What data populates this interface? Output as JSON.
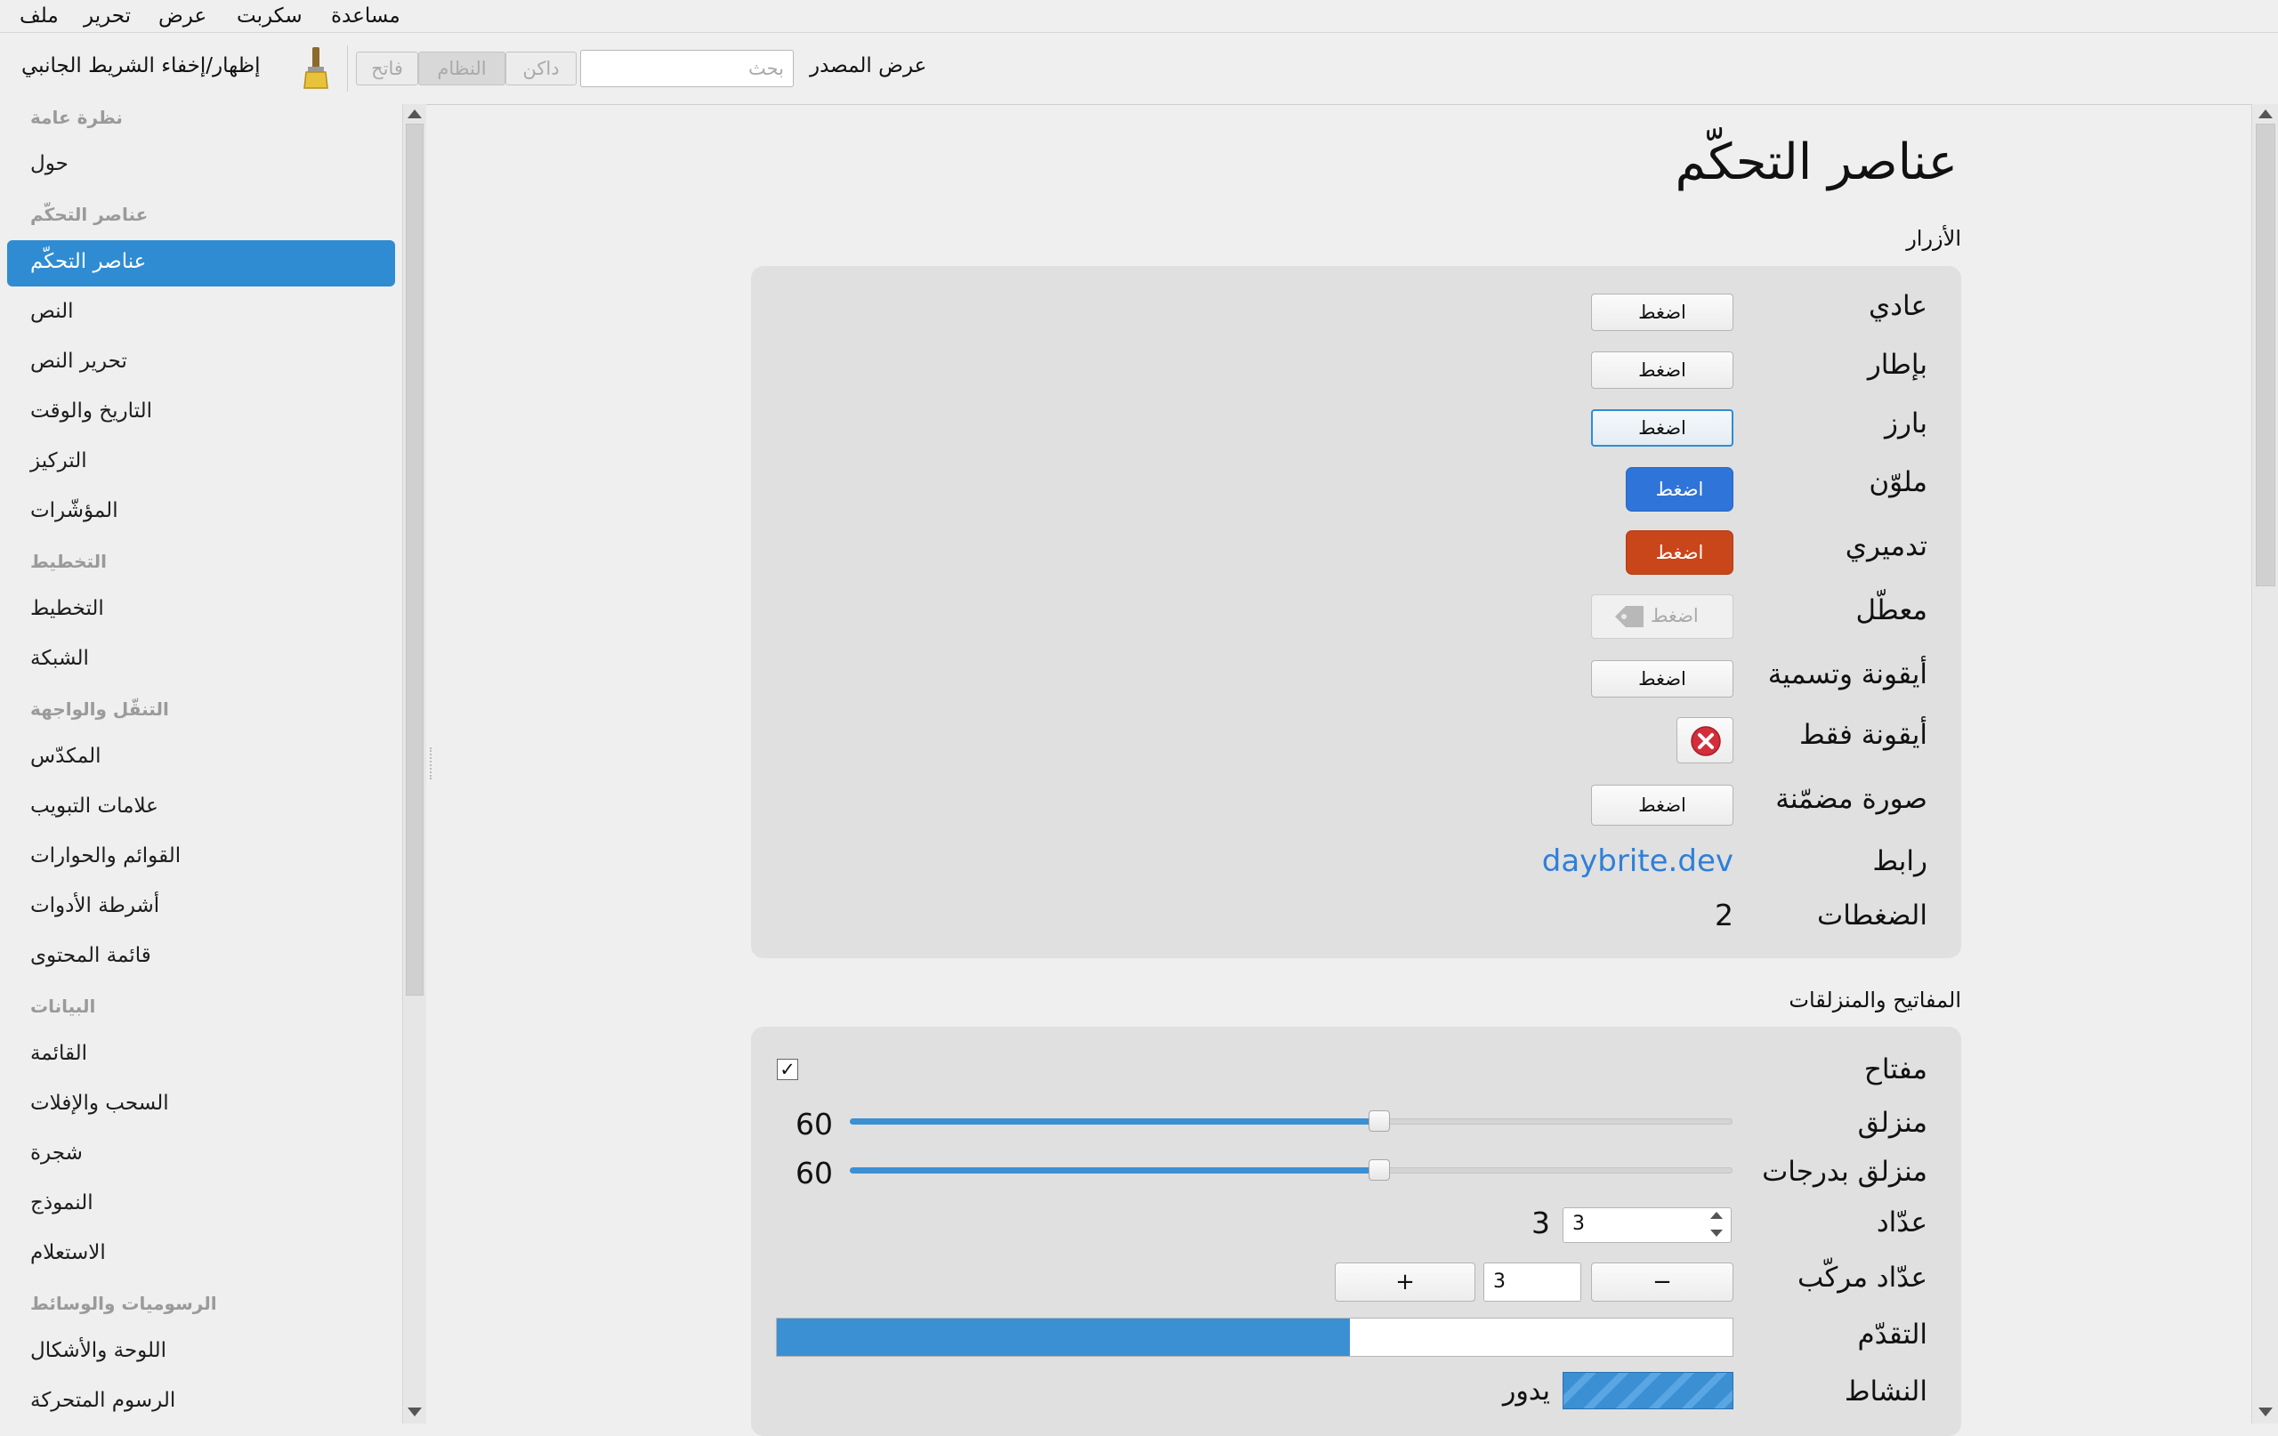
{
  "menubar": {
    "items": [
      "ملف",
      "تحرير",
      "عرض",
      "سكربت",
      "مساعدة"
    ]
  },
  "toolbar": {
    "sidebar_toggle": "إظهار/إخفاء الشريط الجانبي",
    "themes": [
      "فاتح",
      "النظام",
      "داكن"
    ],
    "search_placeholder": "بحث",
    "view_source": "عرض المصدر"
  },
  "sidebar": {
    "sections": [
      {
        "title": "نظرة عامة",
        "items": [
          "حول"
        ]
      },
      {
        "title": "عناصر التحكّم",
        "items": [
          "عناصر التحكّم",
          "النص",
          "تحرير النص",
          "التاريخ والوقت",
          "التركيز",
          "المؤشّرات"
        ]
      },
      {
        "title": "التخطيط",
        "items": [
          "التخطيط",
          "الشبكة"
        ]
      },
      {
        "title": "التنقّل والواجهة",
        "items": [
          "المكدّس",
          "علامات التبويب",
          "القوائم والحوارات",
          "أشرطة الأدوات",
          "قائمة المحتوى"
        ]
      },
      {
        "title": "البيانات",
        "items": [
          "القائمة",
          "السحب والإفلات",
          "شجرة",
          "النموذج",
          "الاستعلام"
        ]
      },
      {
        "title": "الرسوميات والوسائط",
        "items": [
          "اللوحة والأشكال",
          "الرسوم المتحركة"
        ]
      }
    ],
    "active": "عناصر التحكّم"
  },
  "content": {
    "title": "عناصر التحكّم",
    "buttons_section": {
      "title": "الأزرار",
      "rows": [
        {
          "label": "عادي",
          "button": "اضغط"
        },
        {
          "label": "بإطار",
          "button": "اضغط"
        },
        {
          "label": "بارز",
          "button": "اضغط"
        },
        {
          "label": "ملوّن",
          "button": "اضغط"
        },
        {
          "label": "تدميري",
          "button": "اضغط"
        },
        {
          "label": "معطّل",
          "button": "اضغط"
        },
        {
          "label": "أيقونة وتسمية",
          "button": "اضغط"
        },
        {
          "label": "أيقونة فقط"
        },
        {
          "label": "صورة مضمّنة",
          "button": "اضغط"
        },
        {
          "label": "رابط",
          "link": "daybrite.dev"
        },
        {
          "label": "الضغطات",
          "value": "2"
        }
      ]
    },
    "switches_section": {
      "title": "المفاتيح والمنزلقات",
      "switch": {
        "label": "مفتاح",
        "checked_glyph": "✓"
      },
      "slider": {
        "label": "منزلق",
        "value": "60",
        "fraction": 0.6
      },
      "stepped_slider": {
        "label": "منزلق بدرجات",
        "value": "60",
        "fraction": 0.6
      },
      "spinner": {
        "label": "عدّاد",
        "value": "3",
        "field": "3"
      },
      "compound_spinner": {
        "label": "عدّاد مركّب",
        "field": "3",
        "minus": "−",
        "plus": "+"
      },
      "progress": {
        "label": "التقدّم",
        "fraction": 0.6
      },
      "activity": {
        "label": "النشاط",
        "state": "يدور"
      }
    }
  },
  "colors": {
    "accent": "#2f8cd2",
    "colored_button": "#2f74d8",
    "destructive_button": "#c9461a"
  }
}
